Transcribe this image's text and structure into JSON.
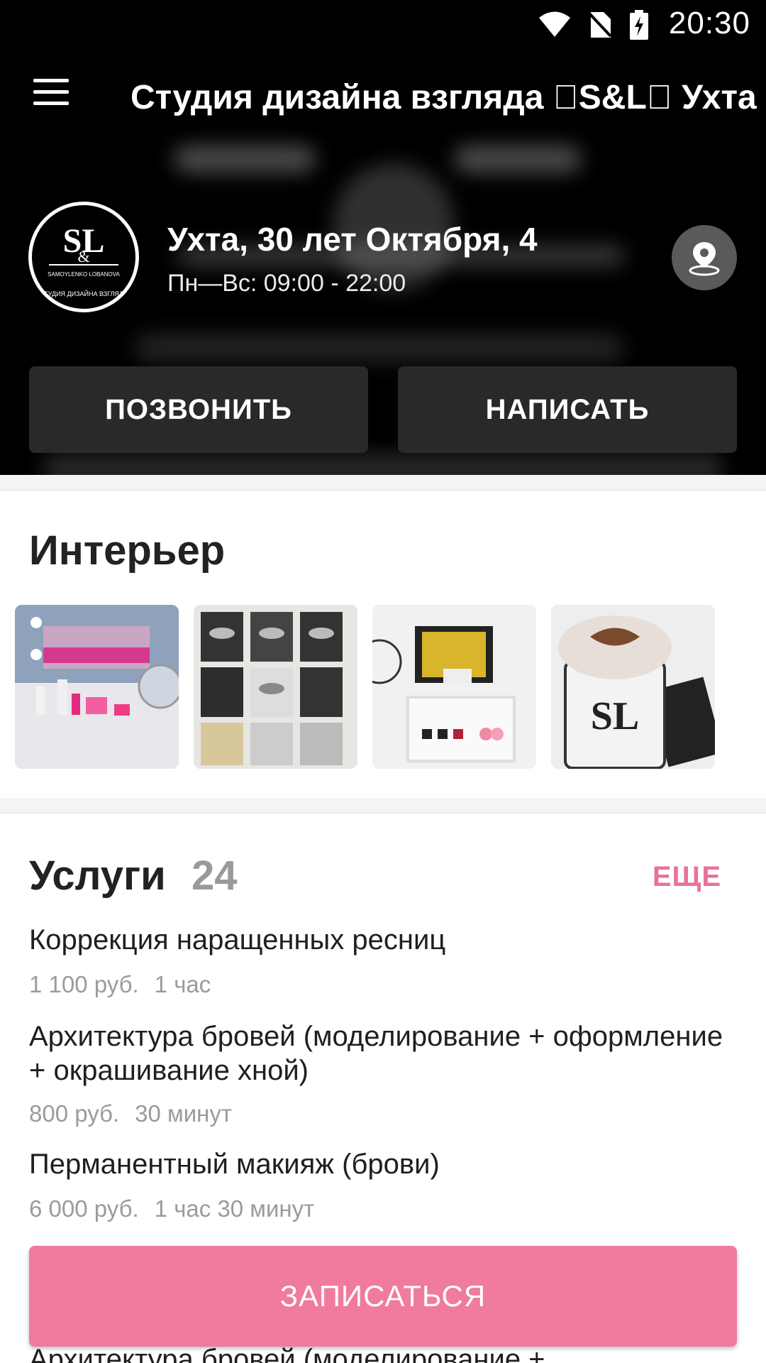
{
  "status": {
    "time": "20:30"
  },
  "appbar": {
    "title": "Студия дизайна взгляда \u0000S&L\u0000 Ухта"
  },
  "salon": {
    "logo_text_top": "SAMOYLENKO LOBANOVA",
    "logo_text_bottom": "СТУДИЯ ДИЗАЙНА ВЗГЛЯДА",
    "address": "Ухта, 30 лет Октября, 4",
    "hours": "Пн—Вс: 09:00 - 22:00"
  },
  "actions": {
    "call_label": "ПОЗВОНИТЬ",
    "write_label": "НАПИСАТЬ"
  },
  "interior": {
    "title": "Интерьер",
    "photos": [
      "manicure-table-photo",
      "certificates-wall-photo",
      "shelf-products-photo",
      "coffee-cup-photo"
    ]
  },
  "services": {
    "title": "Услуги",
    "count": "24",
    "more_label": "ЕЩЕ",
    "items": [
      {
        "name": "Коррекция наращенных ресниц",
        "price": "1 100 руб.",
        "duration": "1 час"
      },
      {
        "name": "Архитектура бровей (моделирование + оформление + окрашивание хной)",
        "price": "800 руб.",
        "duration": "30 минут"
      },
      {
        "name": "Перманентный макияж (брови)",
        "price": "6 000 руб.",
        "duration": "1 час 30 минут"
      }
    ],
    "next_item_partial": "Архитектура бровей (моделирование +"
  },
  "book": {
    "label": "ЗАПИСАТЬСЯ"
  },
  "colors": {
    "accent": "#f17a9f",
    "accent_text": "#ea7198",
    "header_bg": "#000000"
  }
}
